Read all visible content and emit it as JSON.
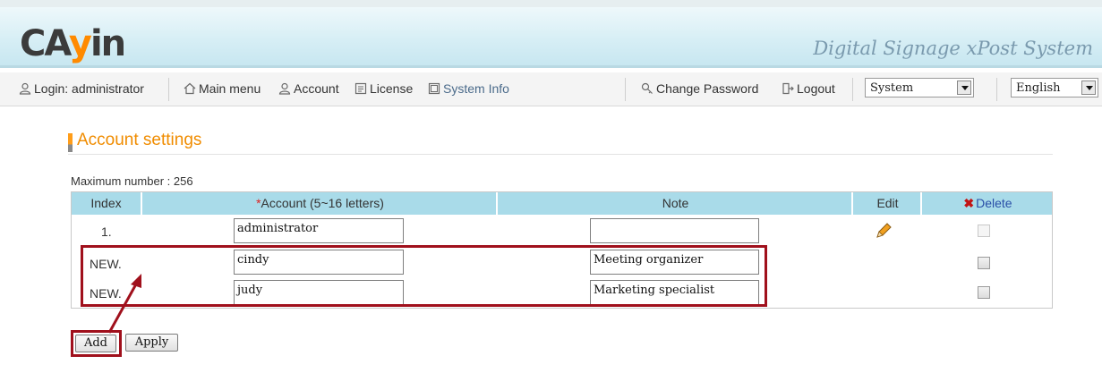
{
  "banner": {
    "logo_text_1": "CA",
    "logo_text_2": "y",
    "logo_text_3": "in",
    "tagline": "Digital Signage xPost System"
  },
  "toolbar": {
    "login_label": "Login:",
    "login_user": "administrator",
    "main_menu": "Main menu",
    "account": "Account",
    "license": "License",
    "system_info": "System Info",
    "change_password": "Change Password",
    "logout": "Logout",
    "system_select": "System",
    "language_select": "English"
  },
  "page": {
    "title": "Account settings",
    "max_number": "Maximum number : 256"
  },
  "table": {
    "headers": {
      "index": "Index",
      "account_req": "*",
      "account": "Account (5~16 letters)",
      "note": "Note",
      "edit": "Edit",
      "delete": "Delete"
    },
    "rows": [
      {
        "index": "1.",
        "account": "administrator",
        "note": ""
      },
      {
        "index": "NEW.",
        "account": "cindy",
        "note": "Meeting organizer"
      },
      {
        "index": "NEW.",
        "account": "judy",
        "note": "Marketing specialist"
      }
    ]
  },
  "buttons": {
    "add": "Add",
    "apply": "Apply"
  },
  "colors": {
    "accent_orange": "#f08c00",
    "table_header": "#a9dbe9",
    "highlight_red": "#a0101c",
    "delete_blue": "#2a4fa8"
  },
  "icons": [
    "user-icon",
    "home-icon",
    "user-icon",
    "license-icon",
    "system-info-icon",
    "key-icon",
    "logout-icon",
    "delete-x-icon",
    "pencil-icon"
  ]
}
